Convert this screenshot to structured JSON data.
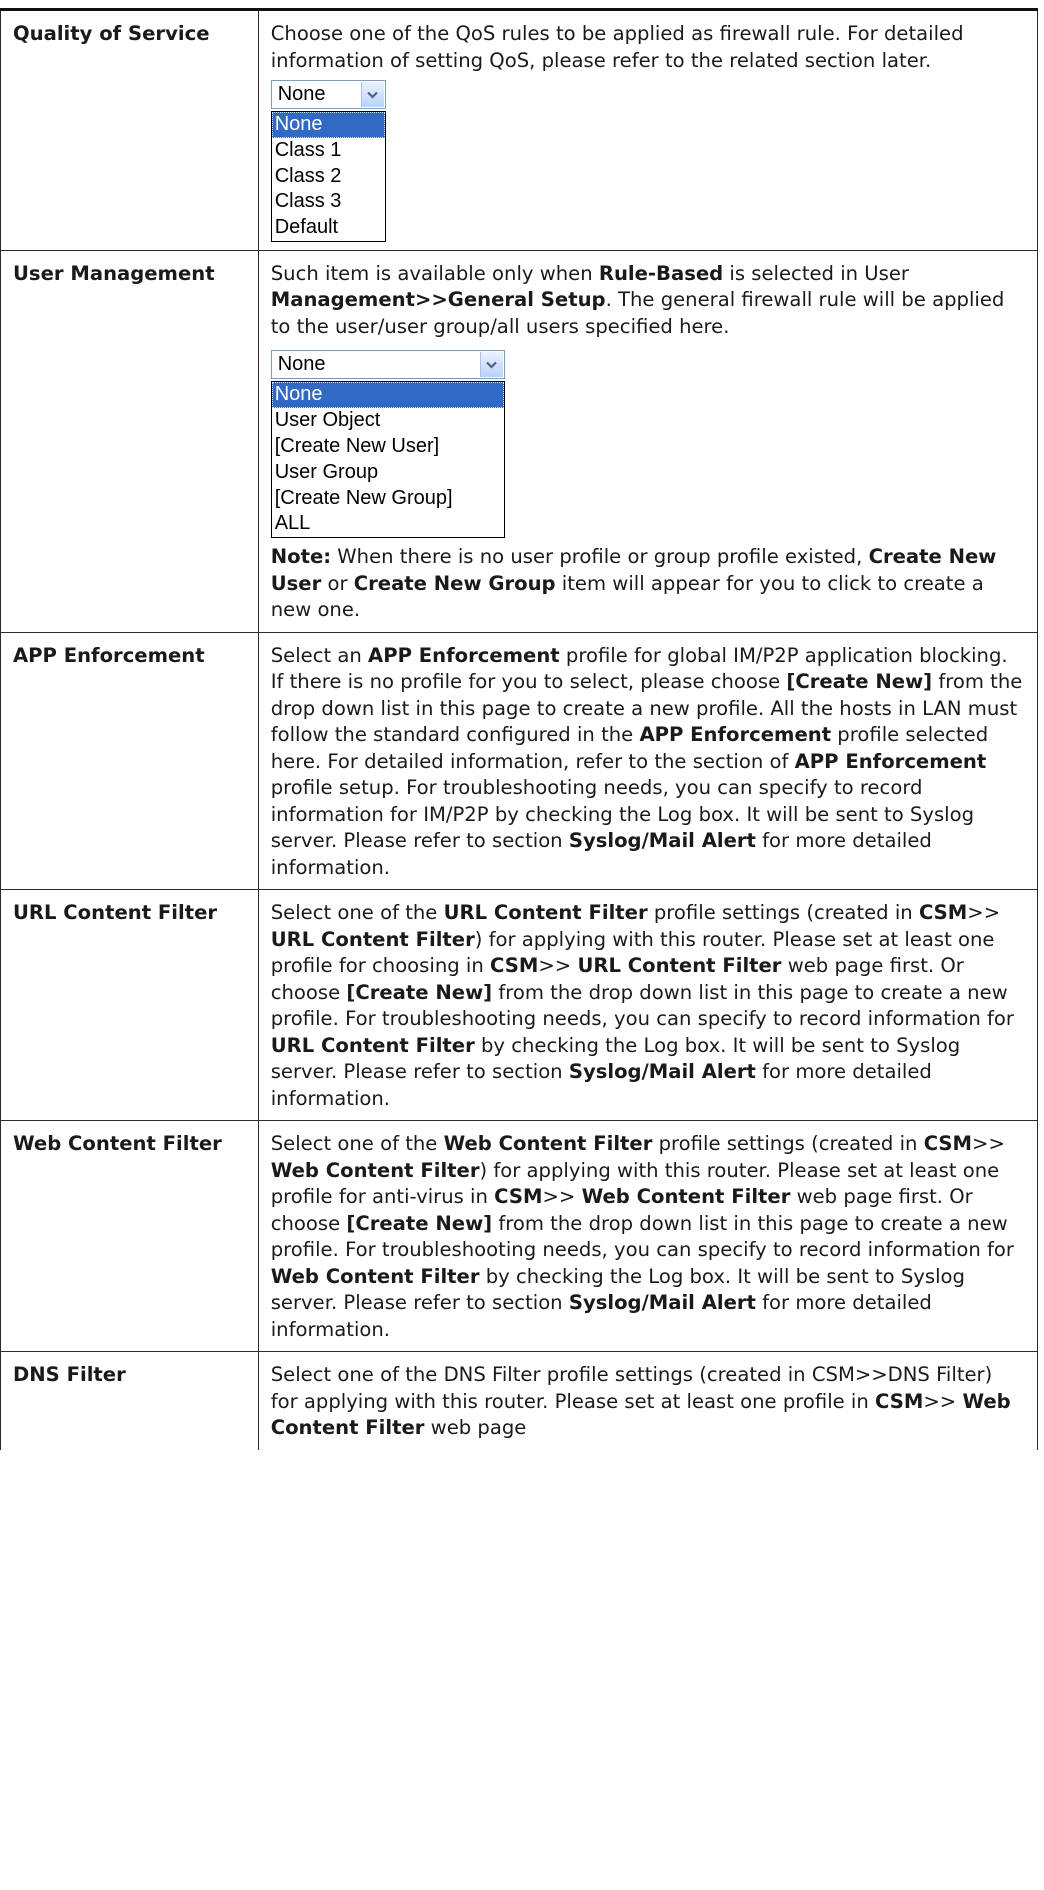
{
  "rows": [
    {
      "term": "Quality of Service",
      "para1": "Choose one of the QoS rules to be applied as firewall rule. For detailed information of setting QoS, please refer to the related section later.",
      "select": {
        "value": "None",
        "options": [
          "None",
          "Class 1",
          "Class 2",
          "Class 3",
          "Default"
        ]
      }
    },
    {
      "term": "User Management",
      "para1": [
        {
          "t": "Such item is available only when "
        },
        {
          "t": "Rule-Based",
          "b": true
        },
        {
          "t": " is selected in User "
        },
        {
          "t": "Management>>General Setup",
          "b": true
        },
        {
          "t": ". The general firewall rule will be applied to the user/user group/all users specified here."
        }
      ],
      "select": {
        "value": "None",
        "options": [
          "None",
          "User Object",
          "[Create New User]",
          "User Group",
          "[Create New Group]",
          "ALL"
        ]
      },
      "note": [
        {
          "t": "Note:",
          "b": true
        },
        {
          "t": " When there is no user profile or group profile existed, "
        },
        {
          "t": "Create New User",
          "b": true
        },
        {
          "t": " or "
        },
        {
          "t": "Create New Group",
          "b": true
        },
        {
          "t": " item will appear for you to click to create a new one."
        }
      ]
    },
    {
      "term": "APP Enforcement",
      "para1": [
        {
          "t": "Select an "
        },
        {
          "t": "APP Enforcement",
          "b": true
        },
        {
          "t": " profile for global IM/P2P application blocking. If there is no profile for you to select, please choose "
        },
        {
          "t": "[Create New]",
          "b": true
        },
        {
          "t": " from the drop down list in this page to create a new profile. All the hosts in LAN must follow the standard configured in the "
        },
        {
          "t": "APP Enforcement",
          "b": true
        },
        {
          "t": " profile selected here. For detailed information, refer to the section of "
        },
        {
          "t": "APP Enforcement",
          "b": true
        },
        {
          "t": " profile setup. For troubleshooting needs, you can specify to record information for IM/P2P by checking the Log box. It will be sent to Syslog server. Please refer to section "
        },
        {
          "t": "Syslog/Mail Alert",
          "b": true
        },
        {
          "t": " for more detailed information."
        }
      ]
    },
    {
      "term": "URL Content Filter",
      "para1": [
        {
          "t": "Select one of the "
        },
        {
          "t": "URL Content Filter",
          "b": true
        },
        {
          "t": " profile settings (created in "
        },
        {
          "t": "CSM",
          "b": true
        },
        {
          "t": ">> "
        },
        {
          "t": "URL Content Filter",
          "b": true
        },
        {
          "t": ") for applying with this router. Please set at least one profile for choosing in "
        },
        {
          "t": "CSM",
          "b": true
        },
        {
          "t": ">> "
        },
        {
          "t": "URL Content Filter",
          "b": true
        },
        {
          "t": " web page first. Or choose "
        },
        {
          "t": "[Create New]",
          "b": true
        },
        {
          "t": " from the drop down list in this page to create a new profile. For troubleshooting needs, you can specify to record information for "
        },
        {
          "t": "URL Content Filter",
          "b": true
        },
        {
          "t": " by checking the Log box. It will be sent to Syslog server. Please refer to section "
        },
        {
          "t": "Syslog/Mail Alert",
          "b": true
        },
        {
          "t": " for more detailed information."
        }
      ]
    },
    {
      "term": "Web Content Filter",
      "para1": [
        {
          "t": "Select one of the "
        },
        {
          "t": "Web Content Filter",
          "b": true
        },
        {
          "t": " profile settings (created in "
        },
        {
          "t": "CSM",
          "b": true
        },
        {
          "t": ">> "
        },
        {
          "t": "Web Content Filter",
          "b": true
        },
        {
          "t": ") for applying with this router. Please set at least one profile for anti-virus in "
        },
        {
          "t": "CSM",
          "b": true
        },
        {
          "t": ">> "
        },
        {
          "t": "Web Content Filter",
          "b": true
        },
        {
          "t": " web page first. Or choose "
        },
        {
          "t": "[Create New]",
          "b": true
        },
        {
          "t": " from the drop down list in this page to create a new profile. For troubleshooting needs, you can specify to record information for "
        },
        {
          "t": "Web Content Filter",
          "b": true
        },
        {
          "t": " by checking the Log box. It will be sent to Syslog server. Please refer to section "
        },
        {
          "t": "Syslog/Mail Alert",
          "b": true
        },
        {
          "t": " for more detailed information."
        }
      ]
    },
    {
      "term": "DNS Filter",
      "para1": [
        {
          "t": "Select one of the DNS Filter profile settings (created in CSM>>DNS Filter) for applying with this router. Please set at least one profile in "
        },
        {
          "t": "CSM",
          "b": true
        },
        {
          "t": ">> "
        },
        {
          "t": "Web Content Filter",
          "b": true
        },
        {
          "t": " web page"
        }
      ]
    }
  ],
  "icons": {
    "dropdown_arrow": "chevron-down-icon",
    "arrow_color": "#4d6185"
  },
  "colors": {
    "selection_bg": "#316ac5",
    "text": "#1a1a1a",
    "border": "#2a2a2a"
  }
}
